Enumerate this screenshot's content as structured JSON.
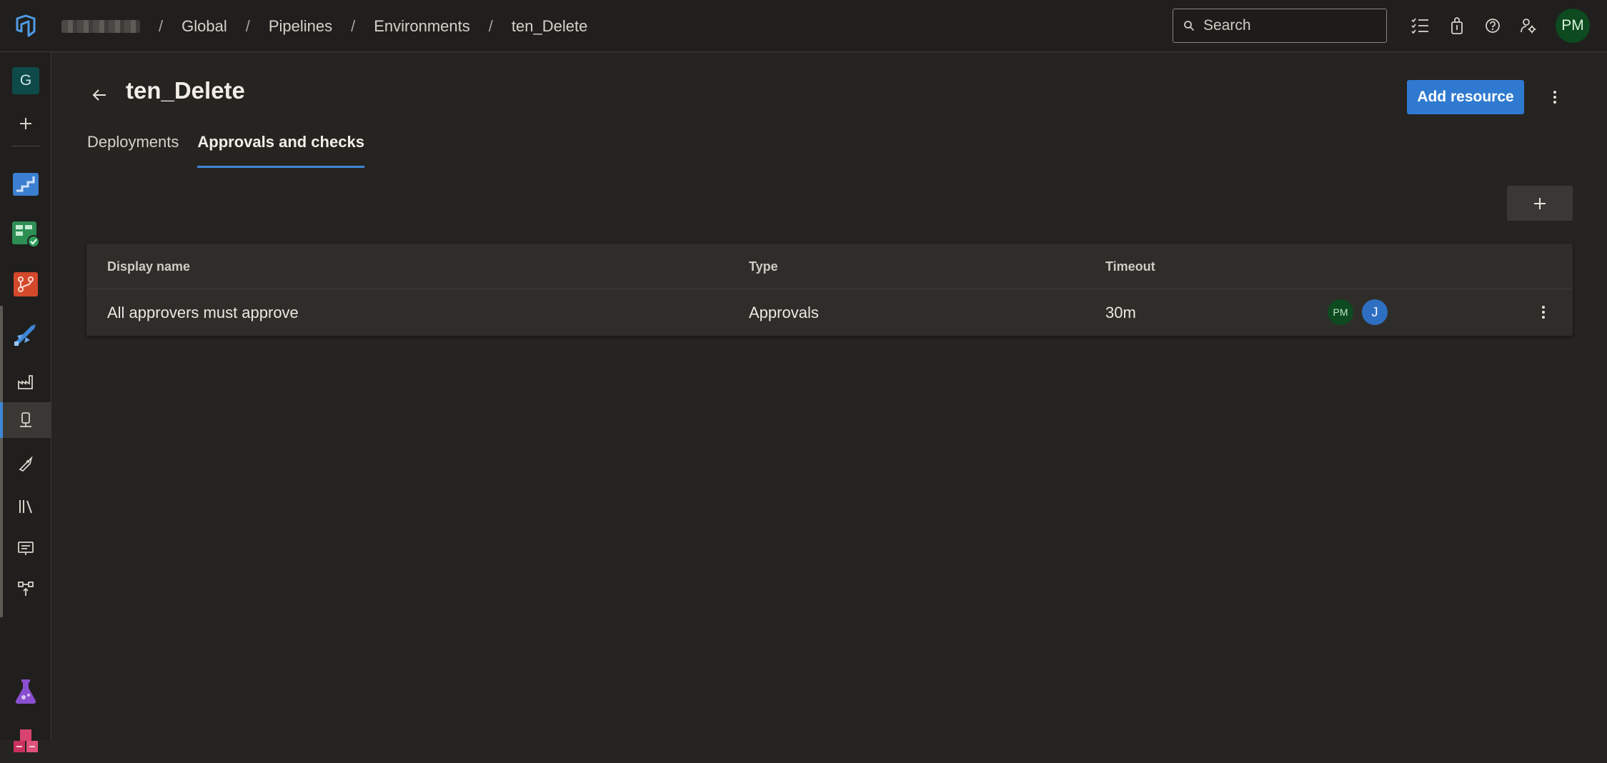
{
  "breadcrumb": {
    "items": [
      "Global",
      "Pipelines",
      "Environments",
      "ten_Delete"
    ],
    "separator": "/"
  },
  "search": {
    "placeholder": "Search"
  },
  "user": {
    "initials": "PM"
  },
  "org": {
    "initial": "G"
  },
  "page": {
    "title": "ten_Delete",
    "add_resource_label": "Add resource",
    "tabs": [
      {
        "label": "Deployments",
        "active": false
      },
      {
        "label": "Approvals and checks",
        "active": true
      }
    ]
  },
  "checks_table": {
    "columns": {
      "name": "Display name",
      "type": "Type",
      "timeout": "Timeout"
    },
    "rows": [
      {
        "name": "All approvers must approve",
        "type": "Approvals",
        "timeout": "30m",
        "approvers": [
          "PM",
          "J"
        ]
      }
    ]
  },
  "colors": {
    "accent": "#2f7ad0",
    "background": "#262421",
    "topbar": "#201f1d",
    "avatar_user": "#0d4a20",
    "avatar_j": "#2f6fc2"
  }
}
